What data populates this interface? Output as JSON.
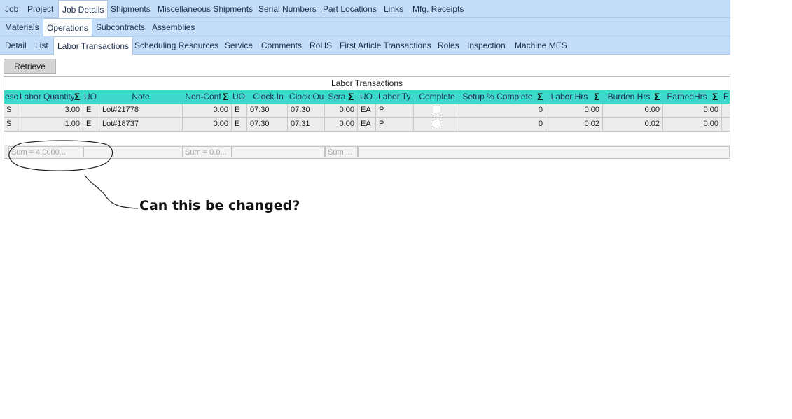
{
  "tabs_row1": [
    {
      "label": "Job",
      "active": false
    },
    {
      "label": "Project",
      "active": false
    },
    {
      "label": "Job Details",
      "active": true
    },
    {
      "label": "Shipments",
      "active": false
    },
    {
      "label": "Miscellaneous Shipments",
      "active": false
    },
    {
      "label": "Serial Numbers",
      "active": false
    },
    {
      "label": "Part Locations",
      "active": false
    },
    {
      "label": "Links",
      "active": false
    },
    {
      "label": "Mfg. Receipts",
      "active": false
    }
  ],
  "tabs_row2": [
    {
      "label": "Materials",
      "active": false
    },
    {
      "label": "Operations",
      "active": true
    },
    {
      "label": "Subcontracts",
      "active": false
    },
    {
      "label": "Assemblies",
      "active": false
    }
  ],
  "tabs_row3": [
    {
      "label": "Detail",
      "active": false
    },
    {
      "label": "List",
      "active": false
    },
    {
      "label": "Labor Transactions",
      "active": true
    },
    {
      "label": "Scheduling Resources",
      "active": false
    },
    {
      "label": "Service",
      "active": false
    },
    {
      "label": "Comments",
      "active": false
    },
    {
      "label": "RoHS",
      "active": false
    },
    {
      "label": "First Article Transactions",
      "active": false
    },
    {
      "label": "Roles",
      "active": false
    },
    {
      "label": "Inspection",
      "active": false
    },
    {
      "label": "Machine MES",
      "active": false
    }
  ],
  "retrieve_button": "Retrieve",
  "grid": {
    "title": "Labor Transactions",
    "columns": [
      "eso",
      "Labor Quantity",
      "UO",
      "Note",
      "Non-Conf",
      "UO",
      "Clock In",
      "Clock Ou",
      "Scra",
      "UO",
      "Labor Ty",
      "Complete",
      "Setup % Complete",
      "Labor Hrs",
      "Burden Hrs",
      "EarnedHrs",
      "E"
    ],
    "rows": [
      {
        "c0": "S",
        "labor_qty": "3.00",
        "uom1": "E",
        "note": "Lot#21778",
        "nonconf": "0.00",
        "uom2": "E",
        "clock_in": "07:30",
        "clock_out": "07:30",
        "scrap": "0.00",
        "uom3": "EA",
        "labor_type": "P",
        "complete": false,
        "setup_pct": "0",
        "labor_hrs": "0.00",
        "burden_hrs": "0.00",
        "earned_hrs": "0.00"
      },
      {
        "c0": "S",
        "labor_qty": "1.00",
        "uom1": "E",
        "note": "Lot#18737",
        "nonconf": "0.00",
        "uom2": "E",
        "clock_in": "07:30",
        "clock_out": "07:31",
        "scrap": "0.00",
        "uom3": "EA",
        "labor_type": "P",
        "complete": false,
        "setup_pct": "0",
        "labor_hrs": "0.02",
        "burden_hrs": "0.02",
        "earned_hrs": "0.00"
      }
    ],
    "sums": {
      "labor_qty": "Sum = 4.0000...",
      "nonconf": "Sum = 0.0...",
      "scrap": "Sum ..."
    }
  },
  "annotation": {
    "text": "Can this be changed?"
  },
  "colors": {
    "tab_bar": "#c3dcf7",
    "grid_header": "#3fd9cc",
    "row_bg": "#ececec"
  }
}
